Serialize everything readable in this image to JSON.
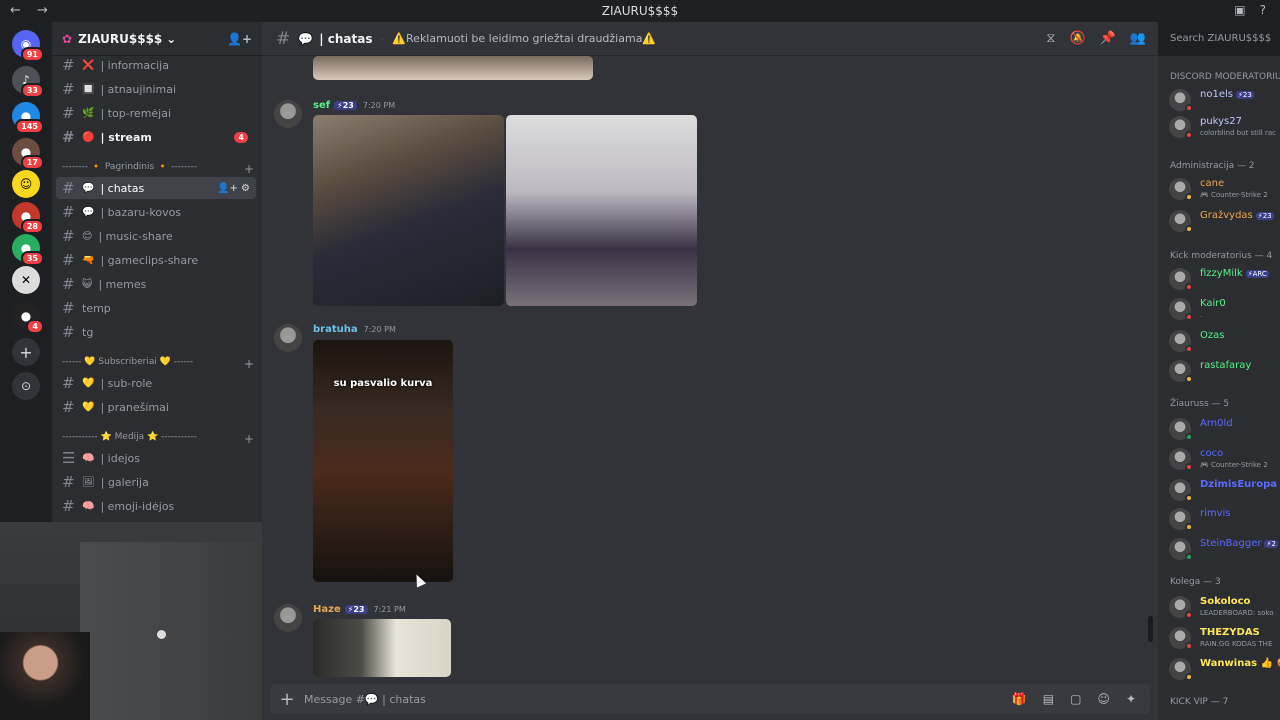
{
  "titlebar": {
    "title": "ZIAURU$$$$"
  },
  "server": {
    "name": "ZIAURU$$$$"
  },
  "guilds": [
    {
      "badge": "91",
      "color": "#5865f2",
      "icon": "discord-home-icon"
    },
    {
      "badge": "33",
      "color": "#4e5058",
      "icon": "server-icon"
    },
    {
      "badge": "145",
      "color": "#1e88e5",
      "icon": "server-icon"
    },
    {
      "badge": "17",
      "color": "#6d4c41",
      "icon": "server-icon"
    },
    {
      "badge": "",
      "color": "#f9d71c",
      "icon": "server-icon"
    },
    {
      "badge": "28",
      "color": "#c0392b",
      "icon": "server-icon"
    },
    {
      "badge": "35",
      "color": "#27ae60",
      "icon": "server-icon"
    },
    {
      "badge": "",
      "color": "#f0f0f0",
      "icon": "server-icon"
    },
    {
      "badge": "4",
      "color": "#222",
      "icon": "server-icon"
    }
  ],
  "channels": [
    {
      "label": "| informacija",
      "emoji": "❌"
    },
    {
      "label": "| atnaujinimai",
      "emoji": "🔲"
    },
    {
      "label": "| top-remėjai",
      "emoji": "🌿"
    },
    {
      "label": "| stream",
      "emoji": "🔴",
      "badge": "4"
    },
    {
      "label": "| chatas",
      "emoji": "💬"
    },
    {
      "label": "| bazaru-kovos",
      "emoji": "💬"
    },
    {
      "label": "| music-share",
      "emoji": "😊"
    },
    {
      "label": "| gameclips-share",
      "emoji": "🔫"
    },
    {
      "label": "| memes",
      "emoji": "😺"
    },
    {
      "label": "temp",
      "emoji": ""
    },
    {
      "label": "tg",
      "emoji": ""
    },
    {
      "label": "| sub-role",
      "emoji": "💛"
    },
    {
      "label": "| pranešimai",
      "emoji": "💛"
    },
    {
      "label": "| idejos",
      "emoji": "🧠"
    },
    {
      "label": "| galerija",
      "emoji": "🖼"
    },
    {
      "label": "| emoji-idėjos",
      "emoji": "🧠"
    }
  ],
  "categories": [
    {
      "label": "-------- 🔸 Pagrindinis 🔸 --------"
    },
    {
      "label": "------ 💛 Subscriberiai 💛 ------"
    },
    {
      "label": "----------- ⭐ Medija ⭐ -----------"
    }
  ],
  "header": {
    "channel": "| chatas",
    "topic": "⚠️Reklamuoti be leidimo griežtai draudžiama⚠️",
    "search_placeholder": "Search ZIAURU$$$$"
  },
  "messages": [
    {
      "author": "sef",
      "color": "#57f287",
      "boost": "23",
      "time": "7:20 PM"
    },
    {
      "author": "bratuha",
      "color": "#6bc3e5",
      "boost": "",
      "time": "7:20 PM",
      "caption": "su pasvalio kurva"
    },
    {
      "author": "Haze",
      "color": "#e8a853",
      "boost": "23",
      "time": "7:21 PM"
    }
  ],
  "composer": {
    "placeholder": "Message #💬 | chatas"
  },
  "member_categories": [
    {
      "label": "DISCORD MODERATORIUS"
    },
    {
      "label": "Administracija — 2"
    },
    {
      "label": "Kick moderatorius — 4"
    },
    {
      "label": "Žiauruss — 5"
    },
    {
      "label": "Kolega — 3"
    },
    {
      "label": "KICK VIP — 7"
    }
  ],
  "members": [
    {
      "name": "no1els",
      "color": "#bfc8ff",
      "status": "#f23f43",
      "boost": "23",
      "sub": ""
    },
    {
      "name": "pukys27",
      "color": "#bfc8ff",
      "status": "#f23f43",
      "boost": "",
      "sub": "colorblind but still rac"
    },
    {
      "name": "cane",
      "color": "#e8a853",
      "status": "#f0b232",
      "boost": "",
      "sub": "🎮 Counter-Strike 2"
    },
    {
      "name": "Gražvydas",
      "color": "#e8a853",
      "status": "#f0b232",
      "boost": "23",
      "sub": ""
    },
    {
      "name": "fizzyMilk",
      "color": "#57f287",
      "status": "#f23f43",
      "boost": "ARC",
      "sub": ""
    },
    {
      "name": "Kair0",
      "color": "#57f287",
      "status": "#f23f43",
      "boost": "",
      "sub": "."
    },
    {
      "name": "Ozas",
      "color": "#57f287",
      "status": "#f23f43",
      "boost": "",
      "sub": ""
    },
    {
      "name": "rastafaray",
      "color": "#57f287",
      "status": "#f0b232",
      "boost": "",
      "sub": ""
    },
    {
      "name": "Arn0ld",
      "color": "#5b6bff",
      "status": "#23a55a",
      "boost": "",
      "sub": ""
    },
    {
      "name": "coco",
      "color": "#5b6bff",
      "status": "#f23f43",
      "boost": "",
      "sub": "🎮 Counter-Strike 2"
    },
    {
      "name": "DzimisEuropa",
      "color": "#5b6bff",
      "status": "#f0b232",
      "boost": "",
      "sub": ""
    },
    {
      "name": "rimvis",
      "color": "#5b6bff",
      "status": "#f0b232",
      "boost": "",
      "sub": ""
    },
    {
      "name": "SteinBagger",
      "color": "#5b6bff",
      "status": "#23a55a",
      "boost": "2",
      "sub": ""
    },
    {
      "name": "Sokoloco",
      "color": "#fee75c",
      "status": "#f23f43",
      "boost": "",
      "sub": "LEADERBOARD: soko"
    },
    {
      "name": "THEZYDAS",
      "color": "#fee75c",
      "status": "#f23f43",
      "boost": "",
      "sub": "RAIN.GG KODAS THE"
    },
    {
      "name": "Wanwinas 👍 🍪",
      "color": "#fee75c",
      "status": "#f0b232",
      "boost": "",
      "sub": ""
    }
  ]
}
